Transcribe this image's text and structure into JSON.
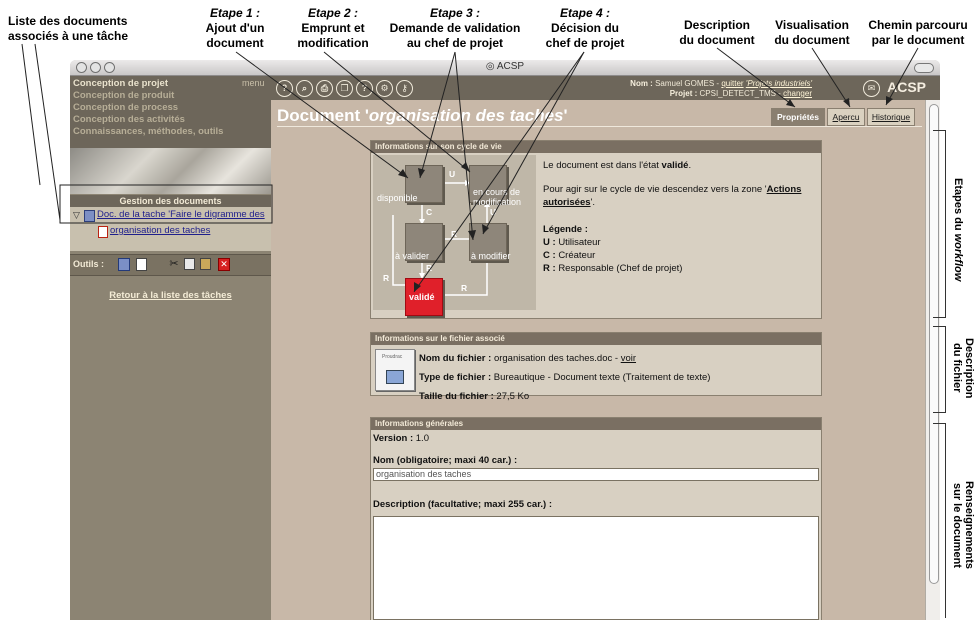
{
  "annotations": {
    "left_label_line1": "Liste des documents",
    "left_label_line2": "associés à une tâche",
    "steps": [
      {
        "step": "Etape 1 :",
        "line1": "Ajout d'un",
        "line2": "document"
      },
      {
        "step": "Etape 2 :",
        "line1": "Emprunt et",
        "line2": "modification"
      },
      {
        "step": "Etape 3 :",
        "line1": "Demande de validation",
        "line2": "au chef de projet"
      },
      {
        "step": "Etape 4 :",
        "line1": "Décision du",
        "line2": "chef de projet"
      }
    ],
    "top_right": [
      {
        "line1": "Description",
        "line2": "du document"
      },
      {
        "line1": "Visualisation",
        "line2": "du document"
      },
      {
        "line1": "Chemin parcouru",
        "line2": "par le document"
      }
    ],
    "side": {
      "workflow_a": "Etapes du ",
      "workflow_b": "workflow",
      "fichier_1": "Description",
      "fichier_2": "du fichier",
      "doc_1": "Renseignements",
      "doc_2": "sur le document"
    }
  },
  "window": {
    "title": "ACSP"
  },
  "sidebar": {
    "menu_label": "menu",
    "menu_items": [
      "Conception de projet",
      "Conception de produit",
      "Conception de process",
      "Conception des activités",
      "Connaissances, méthodes, outils"
    ],
    "gestion_header": "Gestion des documents",
    "tree_parent": "Doc. de la tache 'Faire le digramme des",
    "tree_child": "organisation des taches",
    "tools_label": "Outils :",
    "retour": "Retour à la liste des tâches"
  },
  "header": {
    "nom_label": "Nom :",
    "nom_value": "Samuel GOMES - ",
    "quitter": "quitter",
    "projets": "'Projets industriels'",
    "projet_label": "Projet :",
    "projet_value": "CPSI_DETECT_TMS - ",
    "changer": "changer",
    "brand": "ACSP"
  },
  "document": {
    "title_prefix": "Document '",
    "title_name": "organisation des taches",
    "title_suffix": "'",
    "tabs": [
      "Propriétés",
      "Apercu",
      "Historique"
    ]
  },
  "cycle": {
    "header": "Informations sur son cycle de vie",
    "states": {
      "disponible": "disponible",
      "en_cours_1": "en cours de",
      "en_cours_2": "modification",
      "a_valider": "à valider",
      "a_modifier": "à modifier",
      "valide": "validé"
    },
    "edge_labels": {
      "u": "U",
      "c": "C",
      "r": "R"
    },
    "state_text_a": "Le document est dans l'état ",
    "state_text_b": "validé",
    "state_text_c": ".",
    "action_text_a": "Pour agir sur le cycle de vie descendez vers la zone '",
    "action_text_b": "Actions autorisées",
    "action_text_c": "'.",
    "legend_title": "Légende :",
    "legend": [
      {
        "key": "U :",
        "value": "Utilisateur"
      },
      {
        "key": "C :",
        "value": "Créateur"
      },
      {
        "key": "R :",
        "value": "Responsable (Chef de projet)"
      }
    ]
  },
  "file": {
    "header": "Informations sur le fichier associé",
    "icon_text": "Proudrac",
    "name_label": "Nom du fichier :",
    "name_value": "organisation des taches.doc - ",
    "voir": "voir",
    "type_label": "Type de fichier :",
    "type_value": "Bureautique - Document texte (Traitement de texte)",
    "size_label": "Taille du fichier :",
    "size_value": "27,5 Ko"
  },
  "general": {
    "header": "Informations générales",
    "version_label": "Version :",
    "version_value": "1.0",
    "nom_label": "Nom (obligatoire; maxi 40 car.) :",
    "nom_value": "organisation des taches",
    "desc_label": "Description (facultative; maxi 255 car.) :",
    "desc_value": ""
  }
}
